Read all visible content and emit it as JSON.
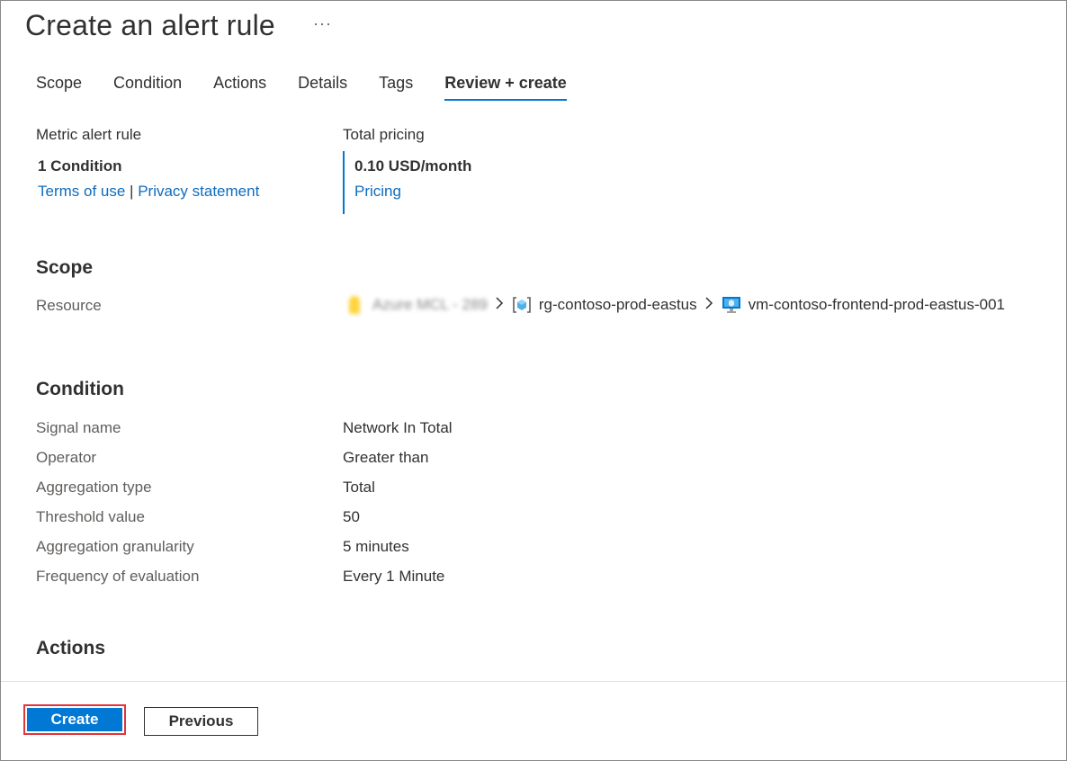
{
  "page": {
    "title": "Create an alert rule",
    "more_label": "···"
  },
  "tabs": [
    {
      "label": "Scope",
      "active": false
    },
    {
      "label": "Condition",
      "active": false
    },
    {
      "label": "Actions",
      "active": false
    },
    {
      "label": "Details",
      "active": false
    },
    {
      "label": "Tags",
      "active": false
    },
    {
      "label": "Review + create",
      "active": true
    }
  ],
  "summary": {
    "rule_type": "Metric alert rule",
    "condition_count": "1 Condition",
    "terms_link": "Terms of use",
    "separator": "|",
    "privacy_link": "Privacy statement",
    "pricing_heading": "Total pricing",
    "price": "0.10 USD/month",
    "pricing_link": "Pricing"
  },
  "scope": {
    "heading": "Scope",
    "resource_label": "Resource",
    "subscription": "Azure MCL - 289",
    "resource_group": "rg-contoso-prod-eastus",
    "vm": "vm-contoso-frontend-prod-eastus-001"
  },
  "condition": {
    "heading": "Condition",
    "rows": [
      {
        "label": "Signal name",
        "value": "Network In Total"
      },
      {
        "label": "Operator",
        "value": "Greater than"
      },
      {
        "label": "Aggregation type",
        "value": "Total"
      },
      {
        "label": "Threshold value",
        "value": "50"
      },
      {
        "label": "Aggregation granularity",
        "value": "5 minutes"
      },
      {
        "label": "Frequency of evaluation",
        "value": "Every 1 Minute"
      }
    ]
  },
  "actions": {
    "heading": "Actions"
  },
  "footer": {
    "create_label": "Create",
    "previous_label": "Previous"
  },
  "colors": {
    "accent": "#0078d4",
    "link": "#0f6cbd",
    "highlight_border": "#e3343b"
  },
  "icons": {
    "subscription": "key-icon",
    "resource_group": "resource-group-icon",
    "vm": "virtual-machine-icon",
    "separator": "chevron-right-icon"
  }
}
